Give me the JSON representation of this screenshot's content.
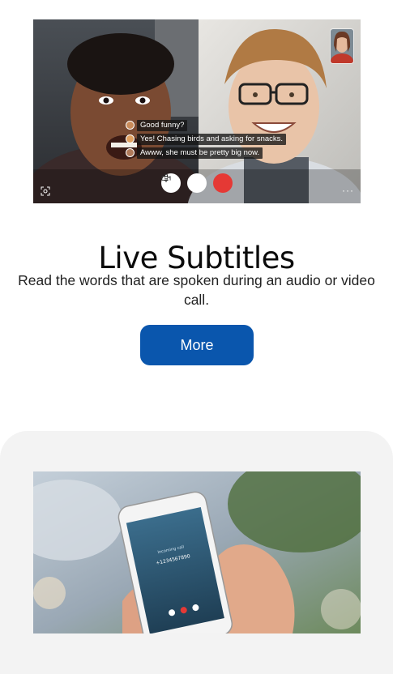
{
  "hero": {
    "subtitles": [
      {
        "text": "Good funny?",
        "color": "#c98b5a"
      },
      {
        "text": "Yes! Chasing birds and asking for snacks.",
        "color": "#e0a060"
      },
      {
        "text": "Awww, she must be pretty big now.",
        "color": "#b07a5a"
      }
    ],
    "controls": [
      "microphone-icon",
      "video-camera-icon",
      "end-call-icon"
    ],
    "end_call_color": "#e53935",
    "more_dots": "···"
  },
  "feature": {
    "title": "Live Subtitles",
    "description": "Read the words that are spoken during an audio or video call.",
    "more_label": "More",
    "button_color": "#0a56ad"
  },
  "phone": {
    "screen_label": "Incoming call",
    "number": "+1234567890"
  }
}
